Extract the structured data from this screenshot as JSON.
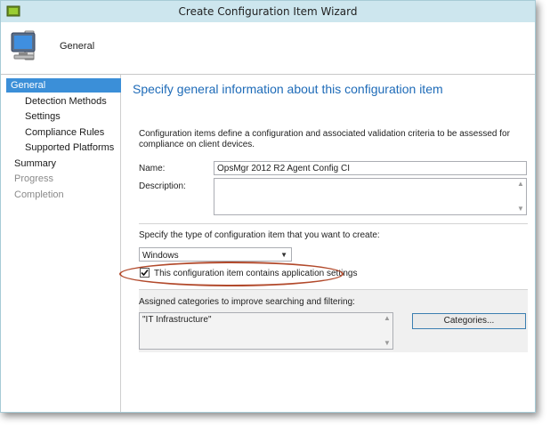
{
  "window": {
    "title": "Create Configuration Item Wizard"
  },
  "header": {
    "title": "General",
    "icon": "computer-monitor-icon"
  },
  "nav": {
    "items": [
      {
        "label": "General",
        "state": "selected"
      },
      {
        "label": "Detection Methods",
        "state": "sub"
      },
      {
        "label": "Settings",
        "state": "sub"
      },
      {
        "label": "Compliance Rules",
        "state": "sub"
      },
      {
        "label": "Supported Platforms",
        "state": "sub"
      },
      {
        "label": "Summary",
        "state": "normal"
      },
      {
        "label": "Progress",
        "state": "disabled"
      },
      {
        "label": "Completion",
        "state": "disabled"
      }
    ]
  },
  "main": {
    "heading": "Specify general information about this configuration item",
    "intro": "Configuration items define a configuration and associated validation criteria to be assessed for compliance on client devices.",
    "name_label": "Name:",
    "name_value": "OpsMgr 2012 R2 Agent Config CI",
    "description_label": "Description:",
    "description_value": "",
    "type_label": "Specify the type of configuration item that you want to create:",
    "type_value": "Windows",
    "app_settings_label": "This configuration item contains application settings",
    "app_settings_checked": true,
    "categories_label": "Assigned categories to improve searching and filtering:",
    "categories_value": "\"IT Infrastructure\"",
    "categories_button": "Categories..."
  },
  "colors": {
    "accent": "#3b8fd8",
    "heading": "#1e6bb8",
    "highlight_oval": "#b24a2c"
  }
}
